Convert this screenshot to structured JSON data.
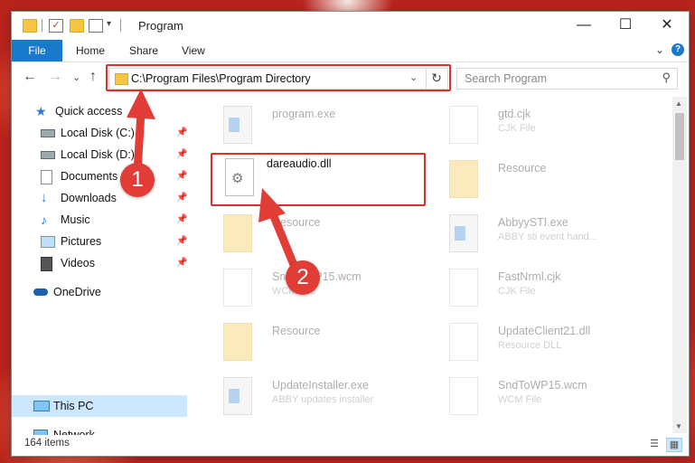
{
  "window": {
    "title": "Program",
    "controls": {
      "minimize": "—",
      "maximize": "☐",
      "close": "✕"
    }
  },
  "ribbon": {
    "tabs": [
      "File",
      "Home",
      "Share",
      "View"
    ],
    "help": "?",
    "collapse": "⌄"
  },
  "nav": {
    "back": "←",
    "forward": "→",
    "recent": "⌄",
    "up": "↑"
  },
  "address": {
    "path": "C:\\Program Files\\Program Directory",
    "dropdown": "⌄",
    "refresh": "↻"
  },
  "search": {
    "placeholder": "Search Program",
    "icon": "⚲"
  },
  "sidebar": {
    "quick_access": "Quick access",
    "items": [
      {
        "label": "Local Disk (C:)",
        "icon": "drive-icon",
        "pinned": true
      },
      {
        "label": "Local Disk (D:)",
        "icon": "drive-icon",
        "pinned": true
      },
      {
        "label": "Documents",
        "icon": "documents-icon",
        "pinned": true
      },
      {
        "label": "Downloads",
        "icon": "downloads-icon",
        "pinned": true
      },
      {
        "label": "Music",
        "icon": "music-icon",
        "pinned": true
      },
      {
        "label": "Pictures",
        "icon": "pictures-icon",
        "pinned": true
      },
      {
        "label": "Videos",
        "icon": "videos-icon",
        "pinned": true
      }
    ],
    "onedrive": "OneDrive",
    "this_pc": "This PC",
    "network": "Network"
  },
  "files": [
    {
      "name": "program.exe",
      "sub": "",
      "type": "exe",
      "faded": true
    },
    {
      "name": "gtd.cjk",
      "sub": "CJK File",
      "type": "doc",
      "faded": true
    },
    {
      "name": "dareaudio.dll",
      "sub": "",
      "type": "dll",
      "faded": false
    },
    {
      "name": "Resource",
      "sub": "",
      "type": "folder",
      "faded": true
    },
    {
      "name": "Resource",
      "sub": "",
      "type": "folder",
      "faded": true
    },
    {
      "name": "AbbyySTI.exe",
      "sub": "ABBY sti event hand...",
      "type": "exe",
      "faded": true
    },
    {
      "name": "SndToWP15.wcm",
      "sub": "WCM File",
      "type": "doc",
      "faded": true
    },
    {
      "name": "FastNrml.cjk",
      "sub": "CJK File",
      "type": "doc",
      "faded": true
    },
    {
      "name": "Resource",
      "sub": "",
      "type": "folder",
      "faded": true
    },
    {
      "name": "UpdateClient21.dll",
      "sub": "Resource DLL",
      "type": "dll",
      "faded": true
    },
    {
      "name": "UpdateInstaller.exe",
      "sub": "ABBY updates installer",
      "type": "exe",
      "faded": true
    },
    {
      "name": "SndToWP15.wcm",
      "sub": "WCM File",
      "type": "doc",
      "faded": true
    }
  ],
  "status": {
    "count": "164 items"
  },
  "callouts": [
    "1",
    "2"
  ],
  "colors": {
    "accent": "#1979ca",
    "highlight": "#d9322c",
    "selection": "#cce8ff"
  }
}
